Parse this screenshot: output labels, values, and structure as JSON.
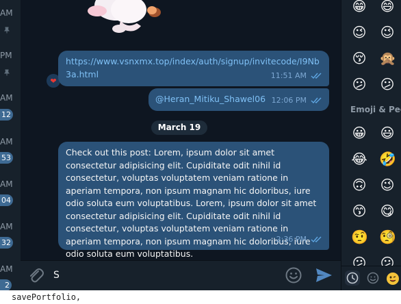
{
  "chat_list": {
    "times": [
      "AM",
      "PM",
      "AM",
      "AM",
      "AM",
      "AM"
    ],
    "badges": [
      "12",
      "53",
      "04",
      "32",
      "2"
    ]
  },
  "messages": {
    "link_message": {
      "text": "https://www.vsnxmx.top/index/auth/signup/invitecode/I9Nb3a.html",
      "time": "11:51 AM",
      "reaction": "heart"
    },
    "mention_message": {
      "text": "@Heran_Mitiku_Shawel06",
      "time": "12:06 PM"
    },
    "date_separator": "March 19",
    "post_message": {
      "text": "Check out this post: Lorem, ipsum dolor sit amet consectetur adipisicing elit. Cupiditate odit nihil id consectetur, voluptas voluptatem veniam ratione in aperiam tempora, non ipsum magnam hic doloribus, iure odio soluta eum voluptatibus. Lorem, ipsum dolor sit amet consectetur adipisicing elit. Cupiditate odit nihil id consectetur, voluptas voluptatem veniam ratione in aperiam tempora, non ipsum magnam hic doloribus, iure odio soluta eum voluptatibus.",
      "time": "2:36 PM"
    }
  },
  "composer": {
    "input_value": "S",
    "attach_icon": "paperclip-icon",
    "emoji_icon": "smiley-icon",
    "send_icon": "send-arrow-icon"
  },
  "emoji_panel": {
    "recent": [
      "😁",
      "😉",
      "😚",
      "😕",
      "😄",
      "😉",
      "🙊",
      "😕"
    ],
    "section_title": "Emoji & Peo",
    "people": [
      "😀",
      "😂",
      "🙃",
      "😙",
      "🤨",
      "😕",
      "😃",
      "🤣",
      "😉",
      "😋",
      "🧐",
      "😕"
    ],
    "tabs": [
      "clock-icon",
      "smiley-icon",
      "emoji-face-icon"
    ]
  },
  "status_bar": {
    "text": "savePortfolio,"
  },
  "colors": {
    "background": "#0e1621",
    "bubble": "#2b5278",
    "panel": "#17212b",
    "link": "#7fc0f5",
    "send_accent": "#5288c1"
  }
}
